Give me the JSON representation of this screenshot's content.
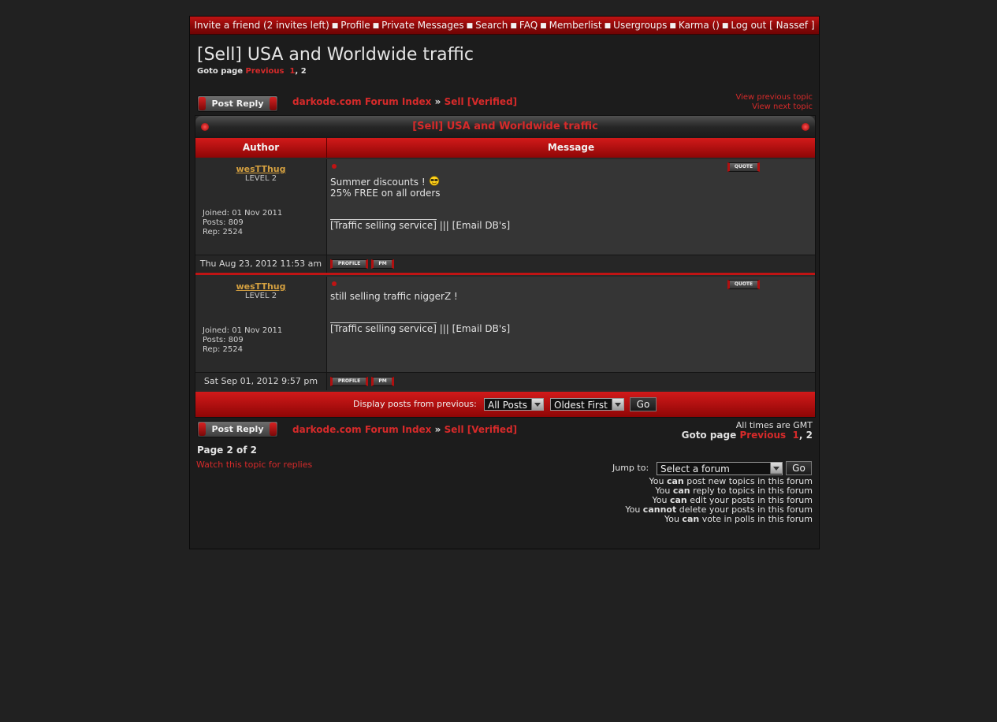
{
  "topbar": {
    "items": [
      "Invite a friend (2 invites left)",
      "Profile",
      "Private Messages",
      "Search",
      "FAQ",
      "Memberlist",
      "Usergroups",
      "Karma ()",
      "Log out [ Nassef ]"
    ],
    "separator": "■"
  },
  "topic": {
    "title": "[Sell] USA and Worldwide traffic",
    "goto_label": "Goto page",
    "prev_label": "Previous",
    "page_1": "1",
    "page_2": "2"
  },
  "actions": {
    "post_reply": "Post Reply",
    "view_previous": "View previous topic",
    "view_next": "View next topic"
  },
  "breadcrumb": {
    "index": "darkode.com Forum Index",
    "sep": "»",
    "forum": "Sell [Verified]"
  },
  "table": {
    "header_title": "[Sell] USA and Worldwide traffic",
    "col_author": "Author",
    "col_message": "Message"
  },
  "posts": [
    {
      "username": "wesTThug",
      "level": "LEVEL 2",
      "joined": "Joined: 01 Nov 2011",
      "posts": "Posts: 809",
      "rep": "Rep: 2524",
      "line1": "Summer discounts !",
      "line2": "25% FREE on all orders",
      "signature": "[Traffic selling service] ||| [Email DB's]",
      "date": "Thu Aug 23, 2012 11:53 am"
    },
    {
      "username": "wesTThug",
      "level": "LEVEL 2",
      "joined": "Joined: 01 Nov 2011",
      "posts": "Posts: 809",
      "rep": "Rep: 2524",
      "line1": "still selling traffic niggerZ !",
      "signature": "[Traffic selling service] ||| [Email DB's]",
      "date": "Sat Sep 01, 2012 9:57 pm"
    }
  ],
  "buttons": {
    "quote": "QUOTE",
    "profile": "PROFILE",
    "pm": "PM"
  },
  "display": {
    "label": "Display posts from previous:",
    "posts_value": "All Posts",
    "order_value": "Oldest First",
    "go": "Go"
  },
  "footer": {
    "timezone": "All times are GMT",
    "goto_label": "Goto page",
    "prev_label": "Previous",
    "page_1": "1",
    "page_2": "2",
    "page_of": "Page 2 of 2",
    "watch": "Watch this topic for replies",
    "jump_label": "Jump to:",
    "jump_value": "Select a forum",
    "jump_go": "Go"
  },
  "permissions": [
    {
      "pre": "You ",
      "verb": "can",
      "post": " post new topics in this forum"
    },
    {
      "pre": "You ",
      "verb": "can",
      "post": " reply to topics in this forum"
    },
    {
      "pre": "You ",
      "verb": "can",
      "post": " edit your posts in this forum"
    },
    {
      "pre": "You ",
      "verb": "cannot",
      "post": " delete your posts in this forum"
    },
    {
      "pre": "You ",
      "verb": "can",
      "post": " vote in polls in this forum"
    }
  ],
  "colors": {
    "accent_red": "#c01414",
    "link_red": "#d62a2a",
    "username_gold": "#d4a040",
    "background": "#212121"
  }
}
